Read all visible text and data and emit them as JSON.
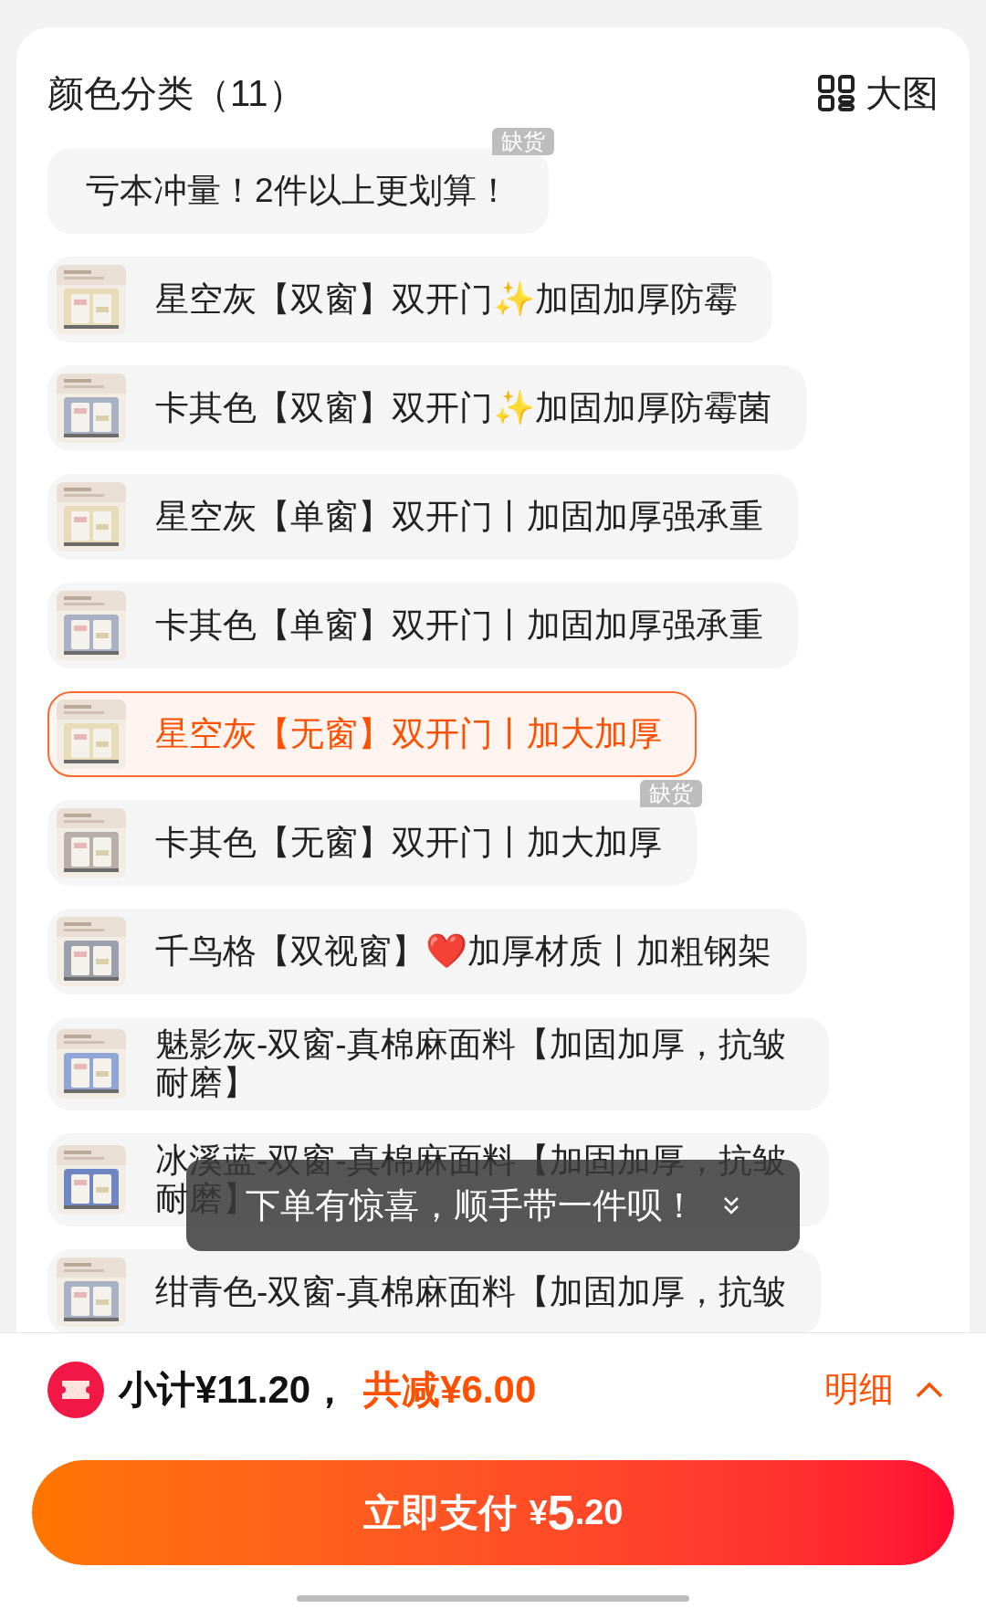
{
  "header": {
    "title": "颜色分类（11）",
    "view_toggle": "大图"
  },
  "options": [
    {
      "kind": "text",
      "label": "亏本冲量！2件以上更划算！",
      "selected": false,
      "badge": "缺货"
    },
    {
      "label": "星空灰【双窗】双开门✨加固加厚防霉",
      "selected": false
    },
    {
      "label": "卡其色【双窗】双开门✨加固加厚防霉菌",
      "selected": false
    },
    {
      "label": "星空灰【单窗】双开门丨加固加厚强承重",
      "selected": false
    },
    {
      "label": "卡其色【单窗】双开门丨加固加厚强承重",
      "selected": false
    },
    {
      "label": "星空灰【无窗】双开门丨加大加厚",
      "selected": true
    },
    {
      "label": "卡其色【无窗】双开门丨加大加厚",
      "selected": false,
      "badge": "缺货"
    },
    {
      "label": "千鸟格【双视窗】❤️加厚材质丨加粗钢架",
      "selected": false
    },
    {
      "label": "魅影灰-双窗-真棉麻面料【加固加厚，抗皱耐磨】",
      "selected": false
    },
    {
      "label": "冰溪蓝-双窗-真棉麻面料【加固加厚，抗皱耐磨】",
      "selected": false
    },
    {
      "label": "绀青色-双窗-真棉麻面料【加固加厚，抗皱",
      "selected": false
    }
  ],
  "toast": "下单有惊喜，顺手带一件呗！",
  "summary": {
    "subtotal": "小计¥11.20，",
    "discount": "共减¥6.00",
    "details": "明细"
  },
  "pay_button": {
    "label": "立即支付",
    "currency": "¥",
    "amount_int": "5",
    "amount_dec": ".20"
  }
}
